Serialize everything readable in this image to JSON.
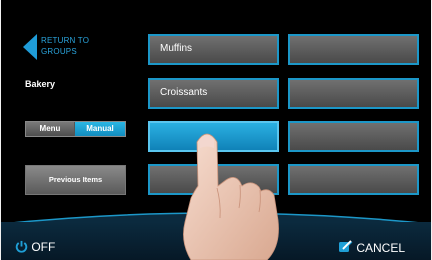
{
  "nav": {
    "back_label": "RETURN TO GROUPS"
  },
  "group": {
    "title": "Bakery"
  },
  "mode_toggle": {
    "menu_label": "Menu",
    "manual_label": "Manual",
    "selected": "Manual"
  },
  "previous_items_label": "Previous Items",
  "tiles": [
    {
      "label": "Muffins"
    },
    {
      "label": ""
    },
    {
      "label": "Croissants"
    },
    {
      "label": ""
    },
    {
      "label": ""
    },
    {
      "label": ""
    },
    {
      "label": ""
    },
    {
      "label": ""
    }
  ],
  "footer": {
    "off_label": "OFF",
    "cancel_label": "CANCEL"
  },
  "colors": {
    "accent": "#1c97c8",
    "active_tile": "#1f9fd6",
    "background": "#000000"
  },
  "icons": {
    "back": "back-arrow-icon",
    "power": "power-icon",
    "cancel": "edit-icon",
    "hand": "pointing-hand"
  }
}
